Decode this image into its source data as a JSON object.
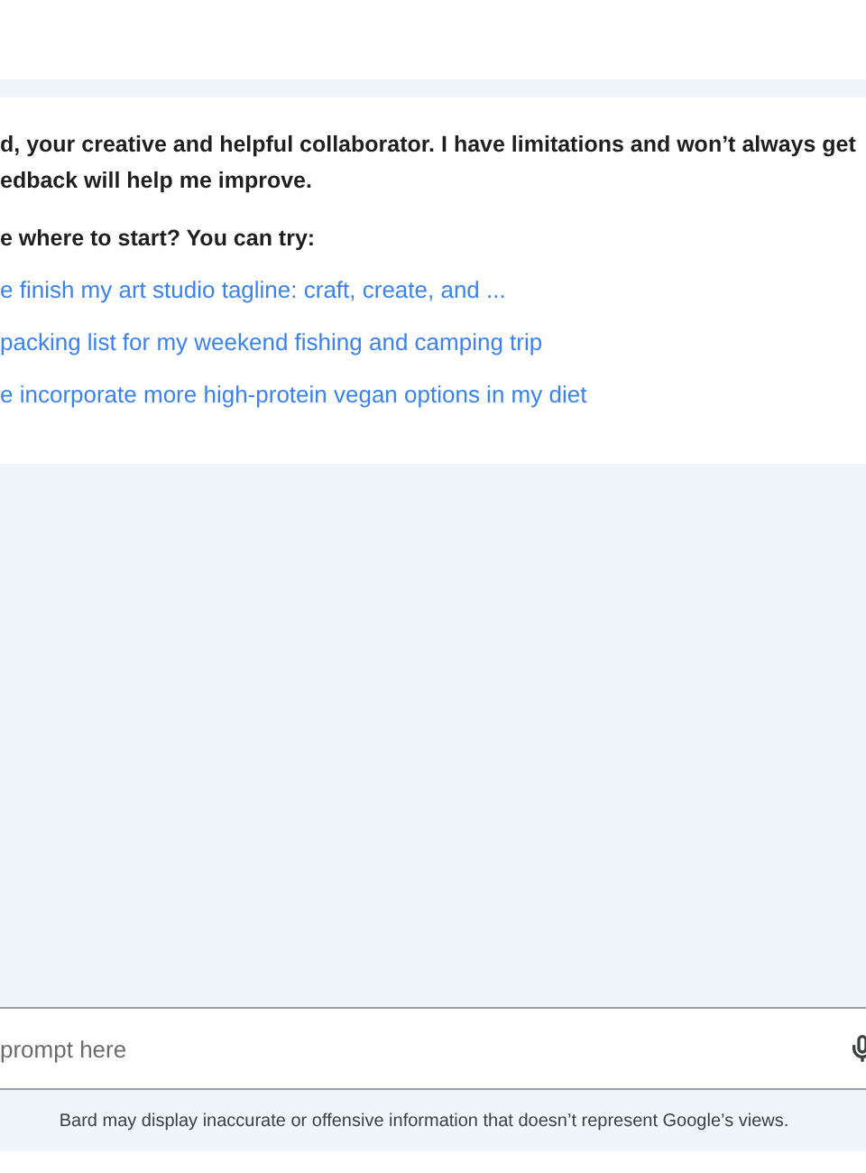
{
  "intro": {
    "lines": [
      "d, your creative and helpful collaborator. I have limitations and won’t always get",
      "edback will help me improve."
    ],
    "question": "e where to start? You can try:"
  },
  "suggestions": [
    "e finish my art studio tagline: craft, create, and ...",
    "packing list for my weekend fishing and camping trip",
    "e incorporate more high-protein vegan options in my diet"
  ],
  "prompt": {
    "placeholder": "prompt here"
  },
  "disclaimer": "Bard may display inaccurate or offensive information that doesn’t represent Google’s views."
}
